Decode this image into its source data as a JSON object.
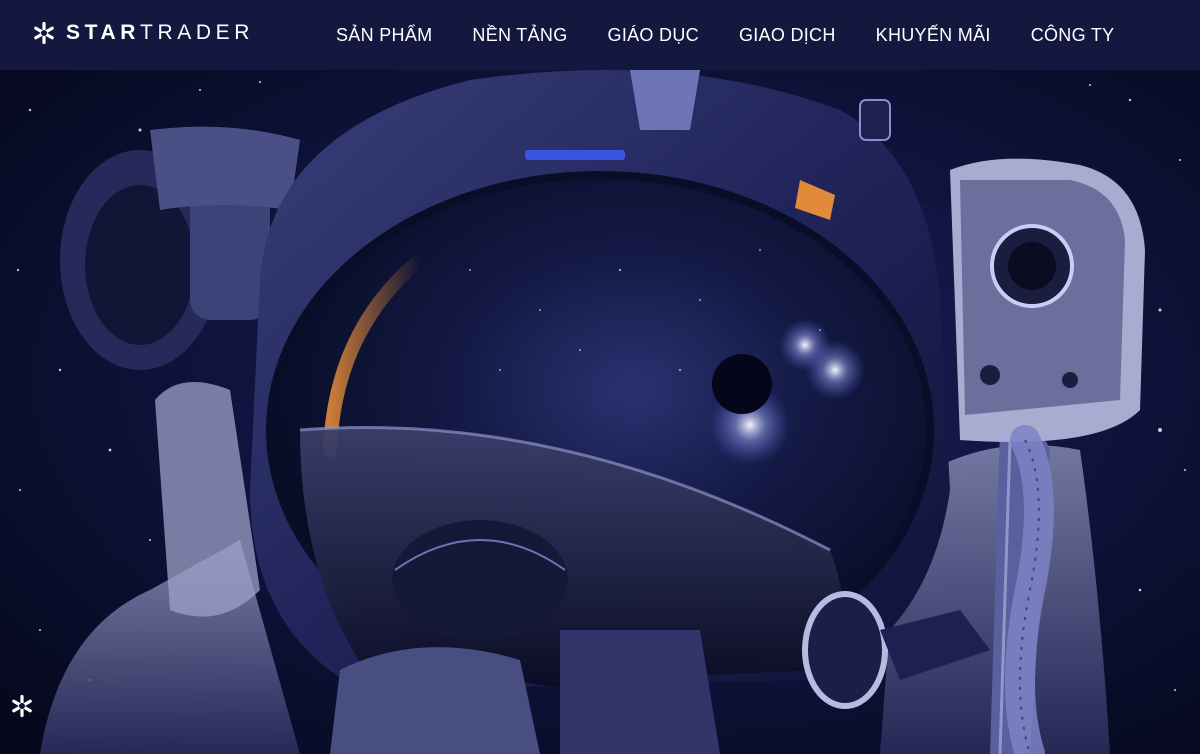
{
  "brand": {
    "name_bold": "STAR",
    "name_light": "TRADER",
    "logo_icon": "asterisk-star-icon",
    "logo_color": "#ffffff"
  },
  "nav": {
    "items": [
      {
        "label": "SẢN PHẨM"
      },
      {
        "label": "NỀN TẢNG"
      },
      {
        "label": "GIÁO DỤC"
      },
      {
        "label": "GIAO DỊCH"
      },
      {
        "label": "KHUYẾN MÃI"
      },
      {
        "label": "CÔNG TY"
      }
    ],
    "background": "#14183f",
    "text_color": "#ffffff"
  },
  "hero": {
    "image": "astronaut-helmet-in-space",
    "palette": {
      "space": "#0b0f2e",
      "visor": "#101535",
      "highlight": "#c9cdf5",
      "accent_orange": "#e08a3a"
    }
  },
  "badge": {
    "icon": "asterisk-star-icon"
  }
}
